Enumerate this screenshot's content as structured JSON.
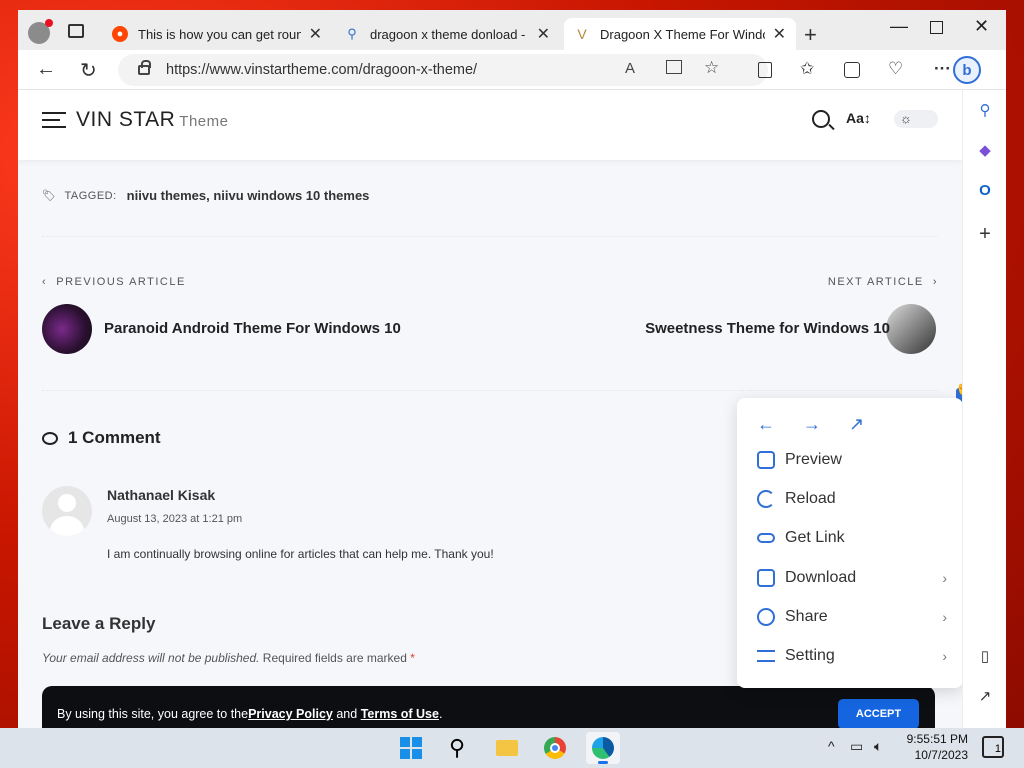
{
  "browser": {
    "tabs": [
      {
        "title": "This is how you can get rounde",
        "favicon": "reddit-icon",
        "active": false
      },
      {
        "title": "dragoon x theme donload - Sea",
        "favicon": "search-icon",
        "active": false
      },
      {
        "title": "Dragoon X Theme For Window",
        "favicon": "vinstar-icon",
        "active": true
      }
    ],
    "url": "https://www.vinstartheme.com/dragoon-x-theme/"
  },
  "site": {
    "brand": "VIN STAR",
    "brand_sub": "Theme",
    "font_toggle": "Aa↕"
  },
  "article": {
    "tagged_label": "TAGGED:",
    "tags": "niivu themes, niivu windows 10 themes",
    "prev_label": "PREVIOUS ARTICLE",
    "prev_title": "Paranoid Android Theme For Windows 10",
    "next_label": "NEXT ARTICLE",
    "next_title": "Sweetness Theme for Windows 10"
  },
  "comments": {
    "heading": "1 Comment",
    "items": [
      {
        "author": "Nathanael Kisak",
        "date": "August 13, 2023 at 1:21 pm",
        "text": "I am continually browsing online for articles that can help me. Thank you!"
      }
    ]
  },
  "reply": {
    "heading": "Leave a Reply",
    "note_italic": "Your email address will not be published.",
    "note_rest": " Required fields are marked ",
    "required_mark": "*"
  },
  "cookie": {
    "text_before": "By using this site, you agree to the ",
    "privacy": "Privacy Policy",
    "and": " and ",
    "terms": "Terms of Use",
    "period": ".",
    "accept": "ACCEPT"
  },
  "context_menu": {
    "items": [
      {
        "label": "Preview",
        "icon": "preview-icon",
        "has_submenu": false
      },
      {
        "label": "Reload",
        "icon": "reload-icon",
        "has_submenu": false
      },
      {
        "label": "Get Link",
        "icon": "link-icon",
        "has_submenu": false
      },
      {
        "label": "Download",
        "icon": "download-icon",
        "has_submenu": true
      },
      {
        "label": "Share",
        "icon": "share-icon",
        "has_submenu": true
      },
      {
        "label": "Setting",
        "icon": "settings-icon",
        "has_submenu": true
      }
    ],
    "accent": "#2f6fd6"
  },
  "taskbar": {
    "time": "9:55:51 PM",
    "date": "10/7/2023",
    "notifications": "1"
  },
  "colors": {
    "accept_button": "#1565e0",
    "cookie_bg": "#0d0e12",
    "page_bg": "#f5f7fb"
  }
}
